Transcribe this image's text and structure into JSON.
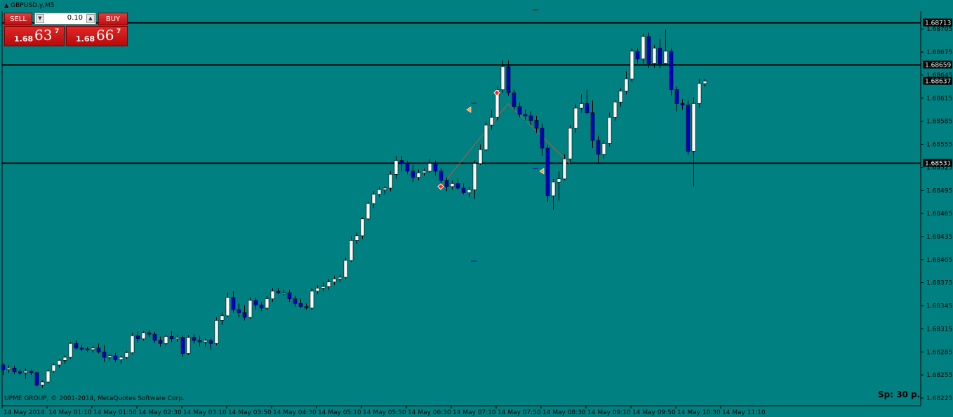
{
  "window": {
    "title": "GBPUSD.y,M5"
  },
  "trade_panel": {
    "sell_label": "SELL",
    "buy_label": "BUY",
    "lot_value": "0.10",
    "sell_price": {
      "prefix": "1.68",
      "big": "63",
      "sup": "7"
    },
    "buy_price": {
      "prefix": "1.68",
      "big": "66",
      "sup": "7"
    }
  },
  "footer": {
    "copyright": "UPME GROUP, © 2001-2014, MetaQuotes Software Corp.",
    "spread": "Sp: 30 p."
  },
  "colors": {
    "background": "#008080",
    "bull": "#ffffff",
    "bear": "#0000c8",
    "wick": "#000000",
    "hline": "#000000"
  },
  "chart_data": {
    "type": "candlestick",
    "symbol": "GBPUSD.y",
    "timeframe": "M5",
    "y_ticks": [
      "1.68705",
      "1.68675",
      "1.68645",
      "1.68615",
      "1.68585",
      "1.68555",
      "1.68525",
      "1.68495",
      "1.68465",
      "1.68435",
      "1.68405",
      "1.68375",
      "1.68345",
      "1.68315",
      "1.68285",
      "1.68255",
      "1.68225"
    ],
    "x_ticks": [
      "14 May 2014",
      "14 May 01:10",
      "14 May 01:50",
      "14 May 02:30",
      "14 May 03:10",
      "14 May 03:50",
      "14 May 04:30",
      "14 May 05:10",
      "14 May 05:50",
      "14 May 06:30",
      "14 May 07:10",
      "14 May 07:50",
      "14 May 08:30",
      "14 May 09:10",
      "14 May 09:50",
      "14 May 10:30",
      "14 May 11:10"
    ],
    "ylim": [
      1.68215,
      1.68728
    ],
    "horizontal_lines": [
      {
        "price": "1.68713"
      },
      {
        "price": "1.68659"
      },
      {
        "price": "1.68531"
      }
    ],
    "current_price_label": "1.68637",
    "candles_ohlc": [
      [
        1.68268,
        1.6827,
        1.68255,
        1.68262
      ],
      [
        1.68262,
        1.68268,
        1.68258,
        1.68264
      ],
      [
        1.68264,
        1.68267,
        1.68256,
        1.68259
      ],
      [
        1.68259,
        1.68262,
        1.68255,
        1.68258
      ],
      [
        1.68258,
        1.68264,
        1.6825,
        1.6826
      ],
      [
        1.6826,
        1.68263,
        1.68255,
        1.68258
      ],
      [
        1.68258,
        1.68259,
        1.6824,
        1.68242
      ],
      [
        1.68242,
        1.68248,
        1.68238,
        1.68246
      ],
      [
        1.68246,
        1.68262,
        1.68244,
        1.6826
      ],
      [
        1.6826,
        1.6827,
        1.68258,
        1.68268
      ],
      [
        1.68268,
        1.68276,
        1.68264,
        1.68274
      ],
      [
        1.68274,
        1.6828,
        1.6827,
        1.68278
      ],
      [
        1.68278,
        1.68298,
        1.68276,
        1.68296
      ],
      [
        1.68296,
        1.683,
        1.68288,
        1.6829
      ],
      [
        1.6829,
        1.68294,
        1.68286,
        1.68289
      ],
      [
        1.68289,
        1.68292,
        1.68285,
        1.68288
      ],
      [
        1.68288,
        1.68292,
        1.68284,
        1.6829
      ],
      [
        1.6829,
        1.68296,
        1.68283,
        1.68285
      ],
      [
        1.68285,
        1.68294,
        1.68272,
        1.68278
      ],
      [
        1.68278,
        1.68282,
        1.68274,
        1.6828
      ],
      [
        1.6828,
        1.68284,
        1.68272,
        1.68275
      ],
      [
        1.68275,
        1.6828,
        1.6827,
        1.68278
      ],
      [
        1.68278,
        1.68286,
        1.68276,
        1.68284
      ],
      [
        1.68284,
        1.6831,
        1.68282,
        1.68306
      ],
      [
        1.68306,
        1.68312,
        1.68298,
        1.68302
      ],
      [
        1.68302,
        1.68312,
        1.683,
        1.6831
      ],
      [
        1.6831,
        1.68314,
        1.68304,
        1.68308
      ],
      [
        1.68308,
        1.68311,
        1.68297,
        1.683
      ],
      [
        1.683,
        1.68305,
        1.68292,
        1.68296
      ],
      [
        1.68296,
        1.68307,
        1.68294,
        1.68305
      ],
      [
        1.68305,
        1.68312,
        1.68298,
        1.68302
      ],
      [
        1.68302,
        1.68307,
        1.68298,
        1.68304
      ],
      [
        1.68304,
        1.68306,
        1.68279,
        1.68283
      ],
      [
        1.68283,
        1.68307,
        1.68281,
        1.68304
      ],
      [
        1.68304,
        1.68308,
        1.68296,
        1.683
      ],
      [
        1.683,
        1.68306,
        1.68292,
        1.68298
      ],
      [
        1.68298,
        1.68302,
        1.68292,
        1.683
      ],
      [
        1.683,
        1.68302,
        1.68288,
        1.68296
      ],
      [
        1.68296,
        1.6833,
        1.68294,
        1.68326
      ],
      [
        1.68326,
        1.68336,
        1.6832,
        1.68332
      ],
      [
        1.68332,
        1.68362,
        1.6833,
        1.68356
      ],
      [
        1.68356,
        1.68364,
        1.68336,
        1.6834
      ],
      [
        1.6834,
        1.68348,
        1.6833,
        1.68336
      ],
      [
        1.68336,
        1.68346,
        1.68326,
        1.6833
      ],
      [
        1.6833,
        1.68356,
        1.68328,
        1.68352
      ],
      [
        1.68352,
        1.68356,
        1.6834,
        1.68346
      ],
      [
        1.68346,
        1.6835,
        1.68338,
        1.68342
      ],
      [
        1.68342,
        1.68358,
        1.6834,
        1.68354
      ],
      [
        1.68354,
        1.68368,
        1.6835,
        1.68364
      ],
      [
        1.68364,
        1.68368,
        1.6836,
        1.68362
      ],
      [
        1.68362,
        1.68366,
        1.68358,
        1.68362
      ],
      [
        1.68362,
        1.68366,
        1.6835,
        1.68354
      ],
      [
        1.68354,
        1.68358,
        1.68344,
        1.68348
      ],
      [
        1.68348,
        1.68354,
        1.68342,
        1.68344
      ],
      [
        1.68344,
        1.68348,
        1.6834,
        1.68342
      ],
      [
        1.68342,
        1.68368,
        1.6834,
        1.68364
      ],
      [
        1.68364,
        1.68372,
        1.6836,
        1.68368
      ],
      [
        1.68368,
        1.68376,
        1.68364,
        1.6837
      ],
      [
        1.6837,
        1.6838,
        1.68366,
        1.68376
      ],
      [
        1.68376,
        1.68384,
        1.68372,
        1.6838
      ],
      [
        1.6838,
        1.68386,
        1.68376,
        1.68382
      ],
      [
        1.68382,
        1.68408,
        1.6838,
        1.68404
      ],
      [
        1.68404,
        1.68436,
        1.68402,
        1.6843
      ],
      [
        1.6843,
        1.6844,
        1.68426,
        1.68436
      ],
      [
        1.68436,
        1.6846,
        1.68432,
        1.68458
      ],
      [
        1.68458,
        1.6848,
        1.68456,
        1.68478
      ],
      [
        1.68478,
        1.68494,
        1.68472,
        1.6849
      ],
      [
        1.6849,
        1.685,
        1.68486,
        1.68496
      ],
      [
        1.68496,
        1.685,
        1.6849,
        1.68498
      ],
      [
        1.68498,
        1.6852,
        1.68494,
        1.68516
      ],
      [
        1.68516,
        1.6854,
        1.6851,
        1.68534
      ],
      [
        1.68534,
        1.6854,
        1.6852,
        1.6853
      ],
      [
        1.6853,
        1.68534,
        1.68516,
        1.6852
      ],
      [
        1.6852,
        1.68528,
        1.68506,
        1.68512
      ],
      [
        1.68512,
        1.68522,
        1.68508,
        1.68518
      ],
      [
        1.68518,
        1.68524,
        1.68514,
        1.6852
      ],
      [
        1.6852,
        1.68536,
        1.68518,
        1.6853
      ],
      [
        1.6853,
        1.68534,
        1.68514,
        1.6852
      ],
      [
        1.6852,
        1.68524,
        1.68502,
        1.68508
      ],
      [
        1.68508,
        1.68512,
        1.68494,
        1.685
      ],
      [
        1.685,
        1.68508,
        1.68496,
        1.68504
      ],
      [
        1.68504,
        1.6851,
        1.68496,
        1.68498
      ],
      [
        1.68498,
        1.68504,
        1.6849,
        1.68492
      ],
      [
        1.68492,
        1.685,
        1.68486,
        1.68496
      ],
      [
        1.68496,
        1.68534,
        1.68484,
        1.6853
      ],
      [
        1.6853,
        1.68555,
        1.68528,
        1.68548
      ],
      [
        1.68548,
        1.68584,
        1.68546,
        1.6858
      ],
      [
        1.6858,
        1.686,
        1.68574,
        1.6859
      ],
      [
        1.6859,
        1.6863,
        1.68586,
        1.68626
      ],
      [
        1.68626,
        1.68664,
        1.68622,
        1.68656
      ],
      [
        1.68656,
        1.68664,
        1.68618,
        1.68622
      ],
      [
        1.68622,
        1.68626,
        1.686,
        1.68604
      ],
      [
        1.68604,
        1.6861,
        1.6859,
        1.68594
      ],
      [
        1.68594,
        1.686,
        1.68586,
        1.68592
      ],
      [
        1.68592,
        1.68598,
        1.6858,
        1.68586
      ],
      [
        1.68586,
        1.68592,
        1.6857,
        1.68576
      ],
      [
        1.68576,
        1.68582,
        1.6854,
        1.6855
      ],
      [
        1.6855,
        1.68554,
        1.6848,
        1.68488
      ],
      [
        1.68488,
        1.6851,
        1.6847,
        1.68506
      ],
      [
        1.68506,
        1.6852,
        1.68482,
        1.6851
      ],
      [
        1.6851,
        1.68542,
        1.68508,
        1.68536
      ],
      [
        1.68536,
        1.6858,
        1.68532,
        1.68576
      ],
      [
        1.68576,
        1.68608,
        1.6857,
        1.68602
      ],
      [
        1.68602,
        1.6862,
        1.68596,
        1.68608
      ],
      [
        1.68608,
        1.68626,
        1.68594,
        1.68596
      ],
      [
        1.68596,
        1.68612,
        1.6855,
        1.6856
      ],
      [
        1.6856,
        1.68566,
        1.6853,
        1.68542
      ],
      [
        1.68542,
        1.6856,
        1.68536,
        1.68556
      ],
      [
        1.68556,
        1.68596,
        1.68552,
        1.6859
      ],
      [
        1.6859,
        1.68612,
        1.68586,
        1.6861
      ],
      [
        1.6861,
        1.68628,
        1.68604,
        1.68624
      ],
      [
        1.68624,
        1.6865,
        1.6862,
        1.6864
      ],
      [
        1.6864,
        1.6868,
        1.68636,
        1.68676
      ],
      [
        1.68676,
        1.6868,
        1.6866,
        1.68666
      ],
      [
        1.68666,
        1.687,
        1.6866,
        1.68695
      ],
      [
        1.68695,
        1.687,
        1.68654,
        1.6866
      ],
      [
        1.6866,
        1.68684,
        1.68654,
        1.6868
      ],
      [
        1.6868,
        1.68692,
        1.68654,
        1.6866
      ],
      [
        1.6866,
        1.68704,
        1.68658,
        1.68676
      ],
      [
        1.68676,
        1.6868,
        1.68618,
        1.68626
      ],
      [
        1.68626,
        1.6863,
        1.68598,
        1.68608
      ],
      [
        1.68608,
        1.68614,
        1.686,
        1.68606
      ],
      [
        1.68606,
        1.68612,
        1.68542,
        1.68546
      ],
      [
        1.68546,
        1.68616,
        1.685,
        1.68608
      ],
      [
        1.68608,
        1.6864,
        1.68602,
        1.68634
      ],
      [
        1.68634,
        1.6864,
        1.6863,
        1.68637
      ]
    ],
    "signals": [
      {
        "index": 83,
        "type": "arrow-left",
        "label": "",
        "price": 1.686,
        "color": "#ffa020"
      },
      {
        "index": 88,
        "type": "diamond",
        "price": 1.68622,
        "color": "#ff2020"
      },
      {
        "index": 78,
        "type": "diamond",
        "price": 1.685,
        "color": "#ff2020"
      },
      {
        "index": 96,
        "type": "arrow-left",
        "price": 1.6852,
        "color": "#ffa020"
      }
    ]
  }
}
